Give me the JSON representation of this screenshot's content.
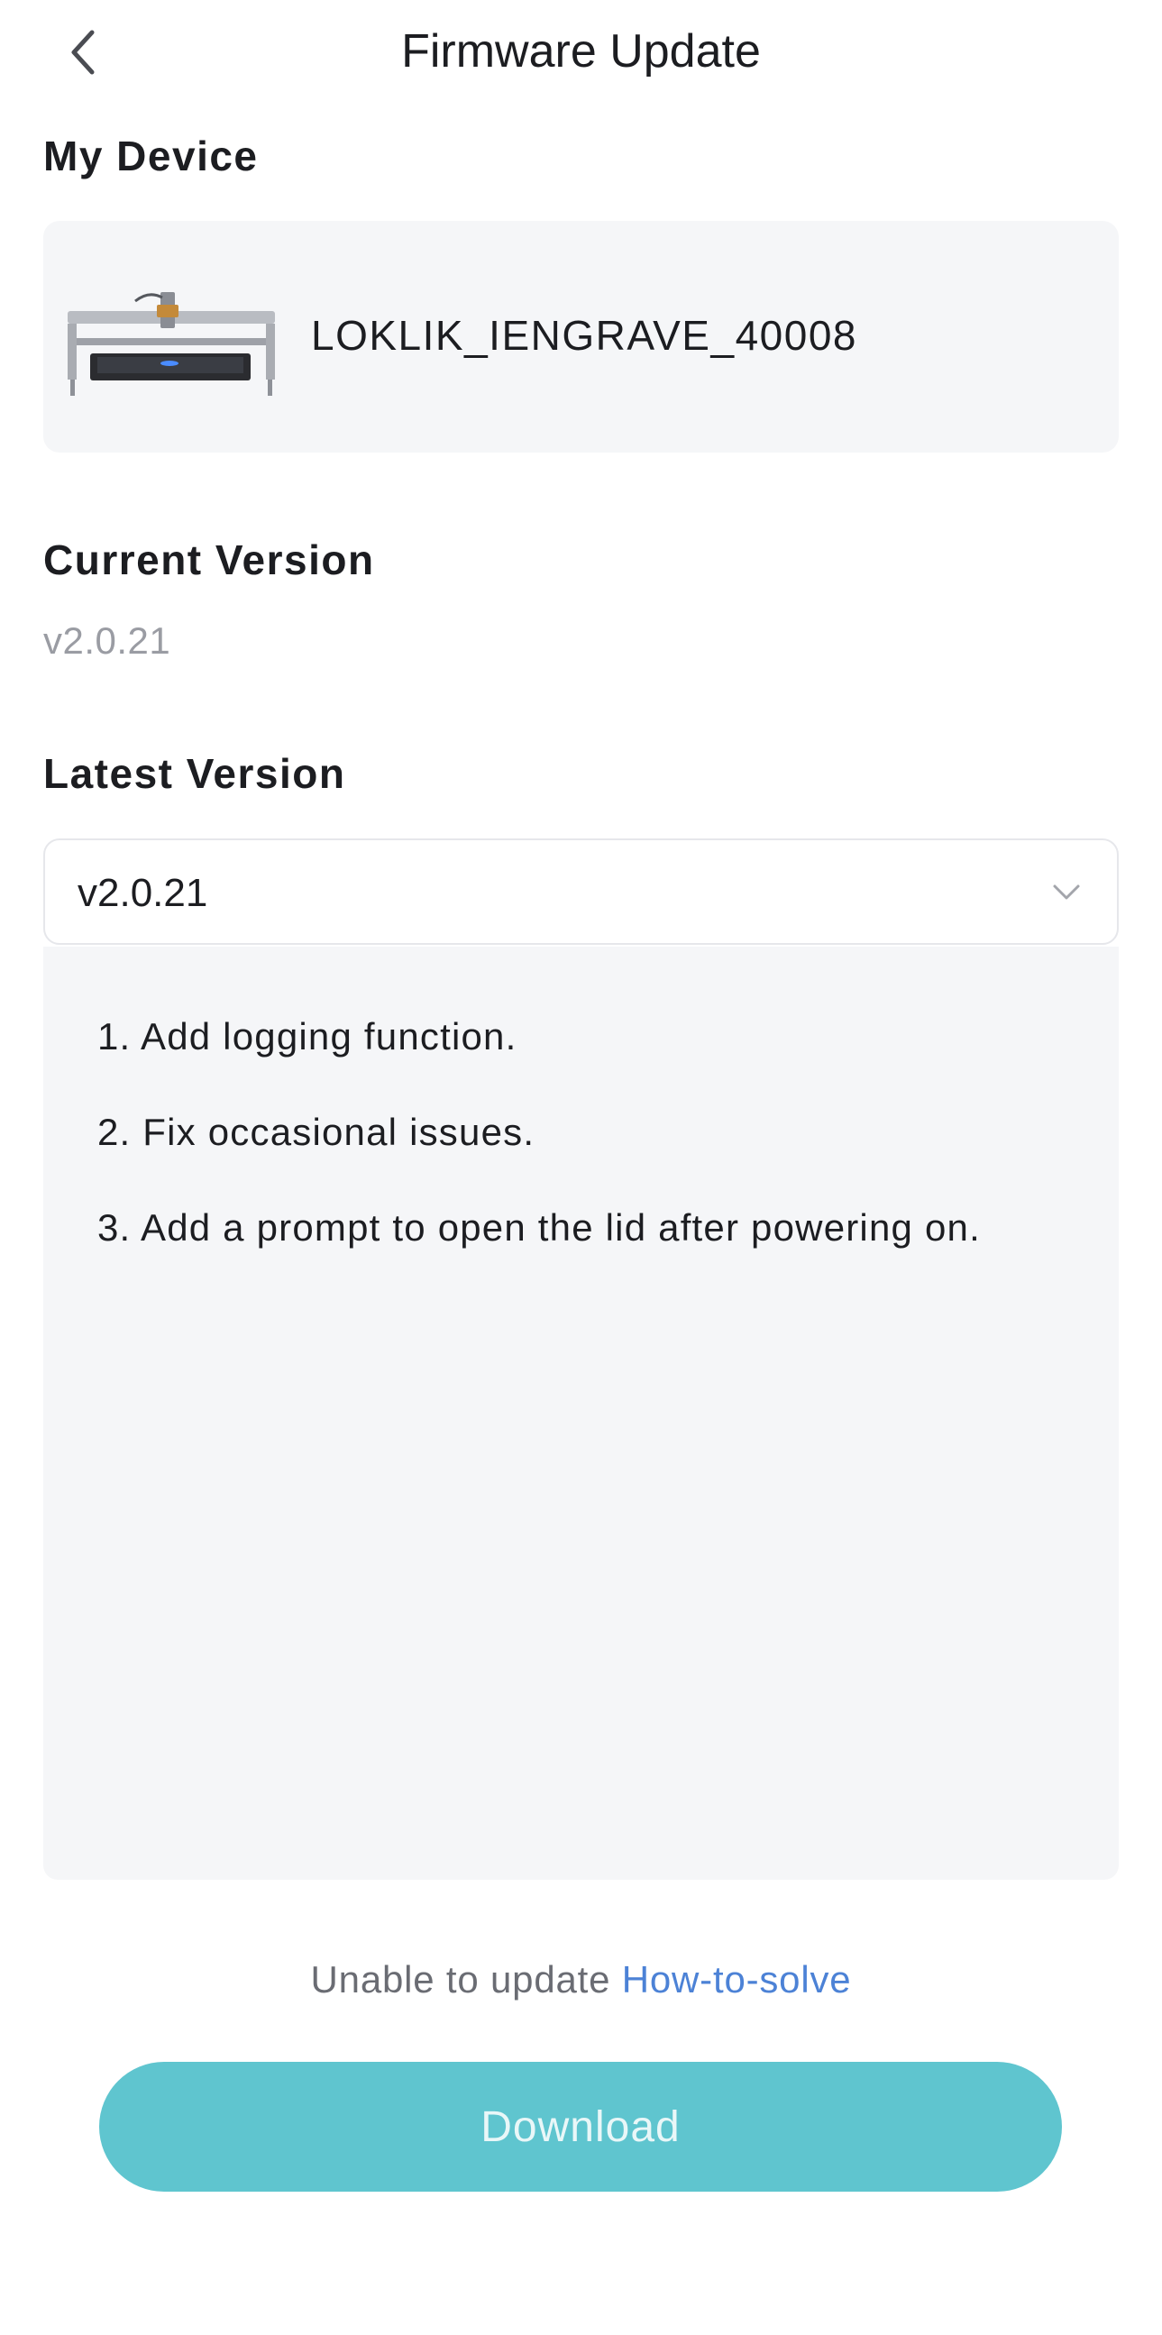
{
  "header": {
    "title": "Firmware Update",
    "back_icon": "chevron-left-icon"
  },
  "device": {
    "section_label": "My Device",
    "name": "LOKLIK_IENGRAVE_40008",
    "image": "laser-engraver-image"
  },
  "current_version": {
    "section_label": "Current Version",
    "value": "v2.0.21"
  },
  "latest_version": {
    "section_label": "Latest Version",
    "selected": "v2.0.21",
    "dropdown_icon": "chevron-down-icon",
    "notes": [
      "1. Add logging function.",
      "2. Fix occasional issues.",
      "3. Add a prompt to open the lid after powering on."
    ]
  },
  "help": {
    "text": "Unable to update",
    "link_label": "How-to-solve"
  },
  "download_button": {
    "label": "Download"
  },
  "colors": {
    "accent": "#5fc5cf",
    "link": "#4c82d6",
    "panel": "#f5f6f8",
    "muted_text": "#9a9ca3"
  }
}
